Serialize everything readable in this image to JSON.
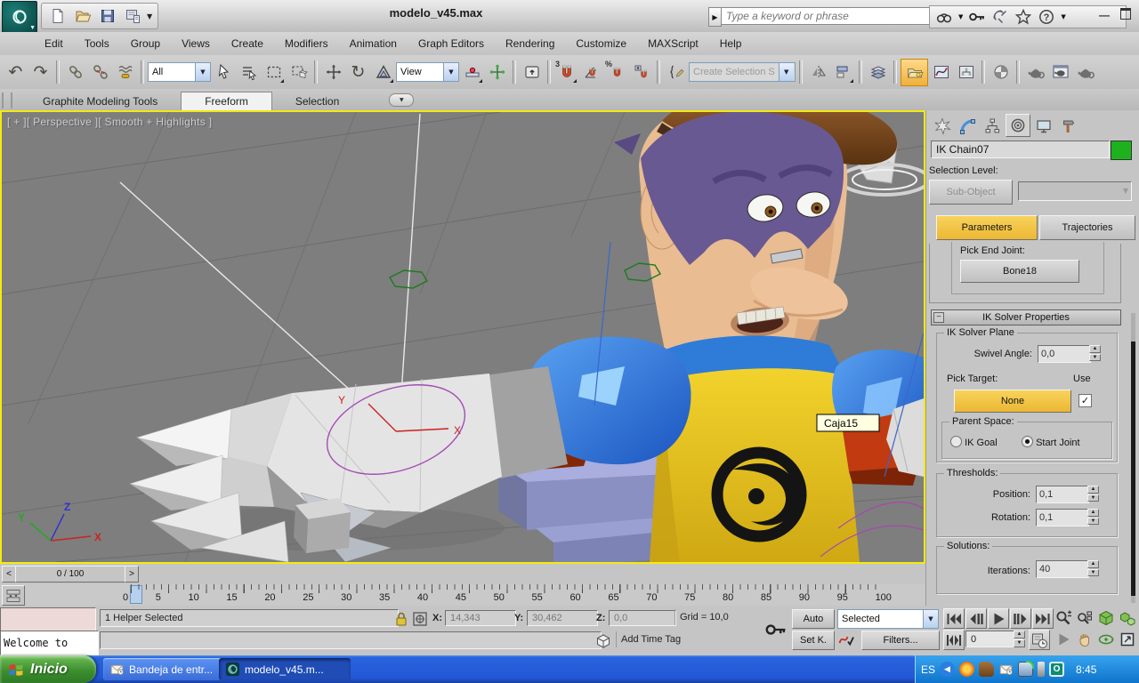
{
  "window": {
    "title": "modelo_v45.max"
  },
  "infocenter": {
    "placeholder": "Type a keyword or phrase"
  },
  "menubar": {
    "items": [
      "Edit",
      "Tools",
      "Group",
      "Views",
      "Create",
      "Modifiers",
      "Animation",
      "Graph Editors",
      "Rendering",
      "Customize",
      "MAXScript",
      "Help"
    ]
  },
  "toolbar": {
    "selection_filter": "All",
    "coord_system": "View",
    "named_selection_placeholder": "Create Selection S",
    "snap_label": "3",
    "percent_label": "%"
  },
  "ribbon": {
    "tabs": [
      "Graphite Modeling Tools",
      "Freeform",
      "Selection"
    ],
    "active_tab": "Freeform"
  },
  "viewport": {
    "label": "[ + ][ Perspective ][ Smooth + Highlights ]",
    "object_tooltip": "Caja15",
    "gizmo_x": "X",
    "gizmo_y": "Y",
    "tripod_x": "X",
    "tripod_y": "Y",
    "tripod_z": "Z"
  },
  "command_panel": {
    "object_name": "IK Chain07",
    "selection_level_label": "Selection Level:",
    "sub_object": "Sub-Object",
    "tab_parameters": "Parameters",
    "tab_trajectories": "Trajectories",
    "pick_end_joint_label": "Pick End Joint:",
    "end_joint_button": "Bone18",
    "rollout_title": "IK Solver Properties",
    "group_ik_plane": "IK Solver Plane",
    "swivel_label": "Swivel Angle:",
    "swivel_value": "0,0",
    "pick_target_label": "Pick Target:",
    "use_label": "Use",
    "pick_target_button": "None",
    "group_parent_space": "Parent Space:",
    "radio_ik_goal": "IK Goal",
    "radio_start_joint": "Start Joint",
    "parent_space_selected": "Start Joint",
    "group_thresholds": "Thresholds:",
    "position_label": "Position:",
    "position_value": "0,1",
    "rotation_label": "Rotation:",
    "rotation_value": "0,1",
    "group_solutions": "Solutions:",
    "iterations_label": "Iterations:",
    "iterations_value": "40"
  },
  "timeline": {
    "slider_label": "0 / 100",
    "prev": "<",
    "next": ">",
    "ticks": [
      "0",
      "5",
      "10",
      "15",
      "20",
      "25",
      "30",
      "35",
      "40",
      "45",
      "50",
      "55",
      "60",
      "65",
      "70",
      "75",
      "80",
      "85",
      "90",
      "95",
      "100"
    ]
  },
  "status_bar": {
    "listener_text": "Welcome to",
    "selection_status": "1 Helper Selected",
    "prompt_text": "",
    "x_label": "X:",
    "x_value": "14,343",
    "y_label": "Y:",
    "y_value": "30,462",
    "z_label": "Z:",
    "z_value": "0,0",
    "grid_info": "Grid = 10,0",
    "add_time_tag": "Add Time Tag",
    "auto_key": "Auto",
    "set_key": "Set K.",
    "key_filter_dropdown": "Selected",
    "filters_button": "Filters...",
    "frame_field": "0"
  },
  "taskbar": {
    "start": "Inicio",
    "tasks": [
      "Bandeja de entr...",
      "modelo_v45.m..."
    ],
    "language": "ES",
    "time": "8:45"
  },
  "icons": {
    "undo": "↶",
    "redo": "↷",
    "rotate": "↻",
    "dropdown_arrow": "▼",
    "oval_arrow": "▼",
    "spinner_up": "▴",
    "spinner_down": "▾",
    "check": "✓",
    "minimize": "—",
    "close": "×",
    "braces": "{ }",
    "arrow_right": "▶",
    "up_key": "⬆"
  },
  "colors": {
    "viewport_border": "#F4EA0E",
    "accent_yellow": "#ECB733",
    "name_swatch_green": "#1DB21D",
    "taskbar_blue": "#2258D6",
    "start_green": "#3D8F2F"
  }
}
